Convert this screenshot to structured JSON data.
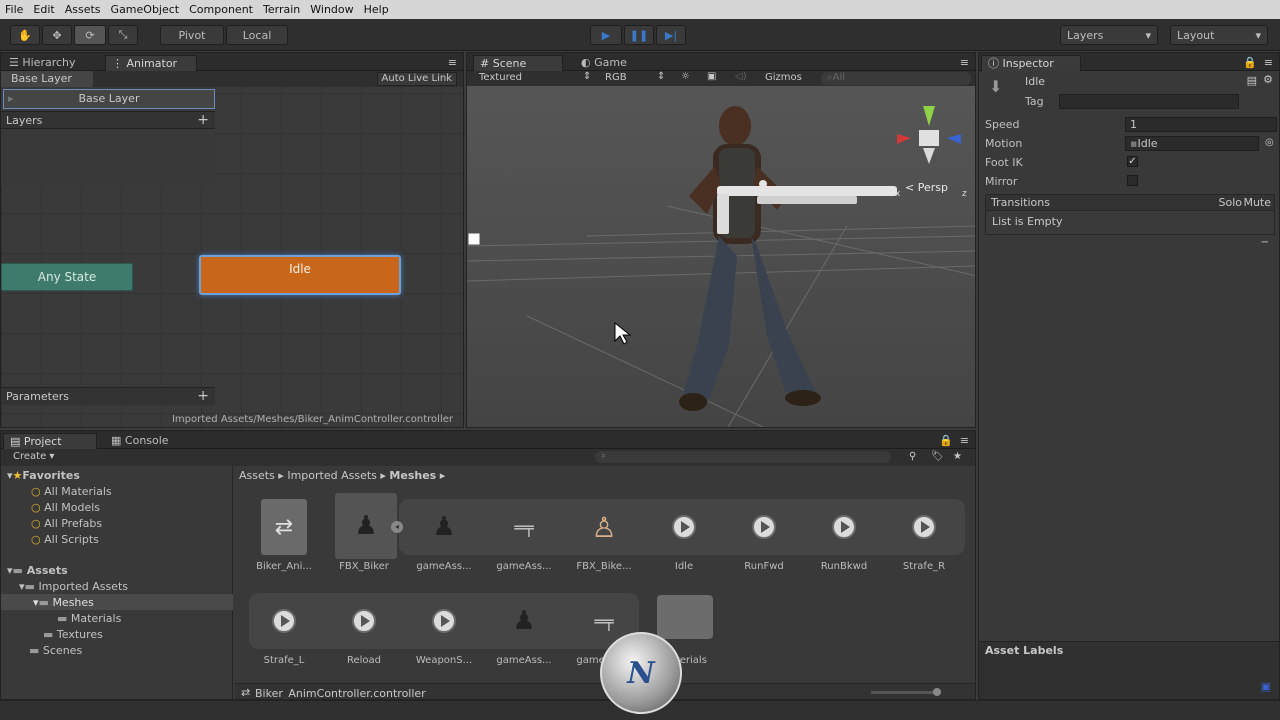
{
  "menu": [
    "File",
    "Edit",
    "Assets",
    "GameObject",
    "Component",
    "Terrain",
    "Window",
    "Help"
  ],
  "toolbar": {
    "pivot": "Pivot",
    "local": "Local",
    "layers": "Layers",
    "layout": "Layout"
  },
  "colors": {
    "accent": "#3a78c8",
    "state_orange": "#c8661c",
    "any_state": "#3f7b6c"
  },
  "animator": {
    "tabs": [
      "Hierarchy",
      "Animator"
    ],
    "breadcrumb": "Base Layer",
    "auto_live_link": "Auto Live Link",
    "layer_row": "Base Layer",
    "layers_label": "Layers",
    "parameters_label": "Parameters",
    "any_state": "Any State",
    "idle_state": "Idle",
    "footer_path": "Imported Assets/Meshes/Biker_AnimController.controller"
  },
  "scene": {
    "tabs": [
      "Scene",
      "Game"
    ],
    "render_mode": "Textured",
    "color_mode": "RGB",
    "gizmos": "Gizmos",
    "search_placeholder": "All",
    "persp": "Persp",
    "axis_y": "y",
    "axis_x": "x",
    "axis_z": "z"
  },
  "inspector": {
    "tab": "Inspector",
    "name": "Idle",
    "tag_label": "Tag",
    "speed_label": "Speed",
    "speed_value": "1",
    "motion_label": "Motion",
    "motion_value": "Idle",
    "foot_ik_label": "Foot IK",
    "foot_ik_checked": true,
    "mirror_label": "Mirror",
    "mirror_checked": false,
    "transitions_label": "Transitions",
    "solo": "Solo",
    "mute": "Mute",
    "list_empty": "List is Empty",
    "asset_labels": "Asset Labels"
  },
  "project": {
    "tabs": [
      "Project",
      "Console"
    ],
    "create": "Create",
    "favorites_label": "Favorites",
    "favorites": [
      "All Materials",
      "All Models",
      "All Prefabs",
      "All Scripts"
    ],
    "assets_label": "Assets",
    "tree": [
      "Imported Assets",
      "Meshes",
      "Materials",
      "Textures",
      "Scenes"
    ],
    "breadcrumb": [
      "Assets",
      "Imported Assets",
      "Meshes"
    ],
    "row1": [
      "Biker_Ani...",
      "FBX_Biker",
      "gameAss...",
      "gameAss...",
      "FBX_Bike...",
      "Idle",
      "RunFwd",
      "RunBkwd",
      "Strafe_R"
    ],
    "row2": [
      "Strafe_L",
      "Reload",
      "WeaponS...",
      "gameAss...",
      "gameAss...",
      "Materials"
    ],
    "footer_file": "Biker_AnimController.controller"
  }
}
